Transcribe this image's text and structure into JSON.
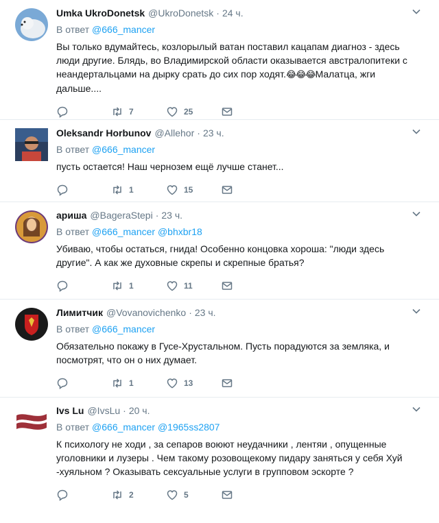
{
  "reply_prefix": "В ответ",
  "tweets": [
    {
      "name": "Umka UkroDonetsk",
      "handle": "@UkroDonetsk",
      "time": "24 ч.",
      "mentions": [
        "@666_mancer"
      ],
      "text_before_emoji": "Вы только вдумайтесь, козлорылый ватан поставил кацапам диагноз - здесь люди другие. Блядь, во Владимирской области оказывается австралопитеки с неандертальцами на дырку срать до сих пор ходят.",
      "emoji": "😂😂😂",
      "text_after_emoji": "Малатца, жги дальше....",
      "replies": "",
      "retweets": "7",
      "likes": "25",
      "avatar_colors": [
        "#7aa9d6",
        "#e9eef3"
      ]
    },
    {
      "name": "Oleksandr Horbunov",
      "handle": "@Allehor",
      "time": "23 ч.",
      "mentions": [
        "@666_mancer"
      ],
      "text": "пусть остается! Наш чернозем ещё лучше станет...",
      "replies": "",
      "retweets": "1",
      "likes": "15",
      "avatar_colors": [
        "#3a5d8c",
        "#c7473b"
      ]
    },
    {
      "name": "ариша",
      "handle": "@BageraStepi",
      "time": "23 ч.",
      "mentions": [
        "@666_mancer",
        "@bhxbr18"
      ],
      "text": "Убиваю, чтобы остаться, гнида! Особенно концовка  хороша: \"люди здесь другие\". А как же духовные скрепы и скрепные братья?",
      "replies": "",
      "retweets": "1",
      "likes": "11",
      "avatar_colors": [
        "#d89a3a",
        "#6b3b7a"
      ]
    },
    {
      "name": "Лимитчик",
      "handle": "@Vovanovichenko",
      "time": "23 ч.",
      "mentions": [
        "@666_mancer"
      ],
      "text": "Обязательно покажу в Гусе-Хрустальном. Пусть порадуются за земляка, и посмотрят, что он о них думает.",
      "replies": "",
      "retweets": "1",
      "likes": "13",
      "avatar_colors": [
        "#1a1a1a",
        "#c8201f"
      ]
    },
    {
      "name": "Ivs Lu",
      "handle": "@IvsLu",
      "time": "20 ч.",
      "mentions": [
        "@666_mancer",
        "@1965ss2807"
      ],
      "text": "К психологу не ходи , за сепаров воюют неудачники , лентяи , опущенные уголовники и лузеры . Чем такому розовощекому пидару заняться у себя Хуй -хуяльном  ? Оказывать сексуальные услуги в групповом  эскорте ?",
      "replies": "",
      "retweets": "2",
      "likes": "5",
      "avatar_colors": [
        "#9e3039",
        "#ffffff"
      ]
    }
  ],
  "colors": {
    "link": "#1da1f2",
    "muted": "#657786",
    "text": "#14171a",
    "divider": "#e6ecf0"
  }
}
